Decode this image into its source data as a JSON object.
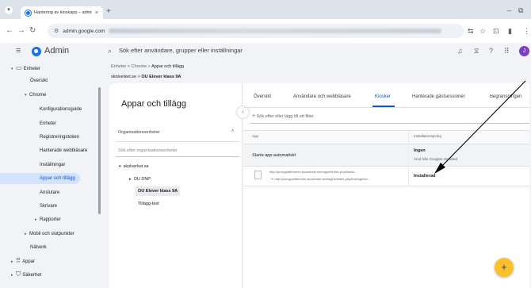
{
  "browser": {
    "tab_title": "Hantering av kioskapp – admin",
    "tab_close": "×",
    "new_tab": "+",
    "url_host": "admin.google.com",
    "min_button": "–",
    "restore_button": "⧉"
  },
  "header": {
    "product": "Admin",
    "search_placeholder": "Sök efter användare, grupper eller inställningar",
    "avatar_letter": "J"
  },
  "sidebar": {
    "items": [
      {
        "label": "Enheter",
        "caret": "▾"
      },
      {
        "label": "Översikt",
        "caret": ""
      },
      {
        "label": "Chrome",
        "caret": "▾"
      },
      {
        "label": "Konfigurationsguide",
        "caret": ""
      },
      {
        "label": "Enheter",
        "caret": ""
      },
      {
        "label": "Registreringstoken",
        "caret": ""
      },
      {
        "label": "Hanterade webbläsare",
        "caret": ""
      },
      {
        "label": "Inställningar",
        "caret": ""
      },
      {
        "label": "Appar och tillägg",
        "caret": ""
      },
      {
        "label": "Anslutare",
        "caret": ""
      },
      {
        "label": "Skrivare",
        "caret": ""
      },
      {
        "label": "Rapporter",
        "caret": "▸"
      },
      {
        "label": "Mobil och slutpunkter",
        "caret": "▸"
      },
      {
        "label": "Nätverk",
        "caret": ""
      },
      {
        "label": "Appar",
        "caret": "▸"
      },
      {
        "label": "Säkerhet",
        "caret": "▸"
      }
    ]
  },
  "breadcrumb": {
    "items": [
      "Enheter",
      "Chrome",
      "Appar och tillägg"
    ],
    "separator": ">"
  },
  "org_path": {
    "root": "skolverket.se",
    "separator": ">",
    "current": "OU Elever klass 9A"
  },
  "left_panel": {
    "title": "Appar och tillägg",
    "ou_header": "Organisationsenheter",
    "ou_search_placeholder": "Sök efter organisationsenheter",
    "tree": [
      {
        "label": "skolverket.se",
        "caret": "▾"
      },
      {
        "label": "OU DNP",
        "caret": "▸"
      },
      {
        "label": "OU Elever klass 9A",
        "caret": ""
      },
      {
        "label": "Tillägg-test",
        "caret": ""
      }
    ]
  },
  "tabs": [
    {
      "label": "Översikt"
    },
    {
      "label": "Användare och webbläsare"
    },
    {
      "label": "Kiosker"
    },
    {
      "label": "Hanterade gästsessioner"
    },
    {
      "label": "Begränsningen"
    }
  ],
  "filter": {
    "plus": "+",
    "label": "Sök efter eller lägg till ett filter"
  },
  "table": {
    "col_app": "App",
    "col_policy": "Installationspolicy",
    "auto_launch_label": "Starta app automatiskt",
    "auto_policy": "Ingen",
    "auto_policy_sub": "Ärvd från Googles standard",
    "app_url_1": "http://proxyplattformen.skolverket.se/engine/index.php/&nbsp;&nbsp;&nbsp;",
    "app_url_2": "http://proxyplattformen.skolverket.se/engine/index.php/&nbsp;&nbsp;&nbsp;",
    "app_status": "Installerad"
  },
  "fab": {
    "icon": "+"
  },
  "colors": {
    "accent": "#0b57d0",
    "fab": "#fbc02d",
    "avatar": "#7b3fc6"
  }
}
